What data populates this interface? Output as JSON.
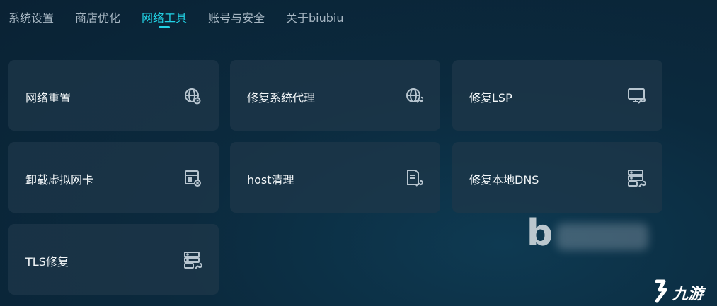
{
  "tabs": [
    {
      "label": "系统设置",
      "active": false
    },
    {
      "label": "商店优化",
      "active": false
    },
    {
      "label": "网络工具",
      "active": true
    },
    {
      "label": "账号与安全",
      "active": false
    },
    {
      "label": "关于biubiu",
      "active": false
    }
  ],
  "cards": [
    {
      "label": "网络重置",
      "icon": "globe-refresh-icon"
    },
    {
      "label": "修复系统代理",
      "icon": "globe-wrench-icon"
    },
    {
      "label": "修复LSP",
      "icon": "monitor-wrench-icon"
    },
    {
      "label": "卸载虚拟网卡",
      "icon": "network-card-remove-icon"
    },
    {
      "label": "host清理",
      "icon": "document-wrench-icon"
    },
    {
      "label": "修复本地DNS",
      "icon": "server-wrench-icon"
    },
    {
      "label": "TLS修复",
      "icon": "server-wrench-icon"
    }
  ],
  "colors": {
    "accent": "#22d3e6",
    "tab_text": "#a6b6c2",
    "card_bg": "#1e384a",
    "icon": "#b7c5cf"
  },
  "watermark": {
    "corner_text": "九游"
  }
}
